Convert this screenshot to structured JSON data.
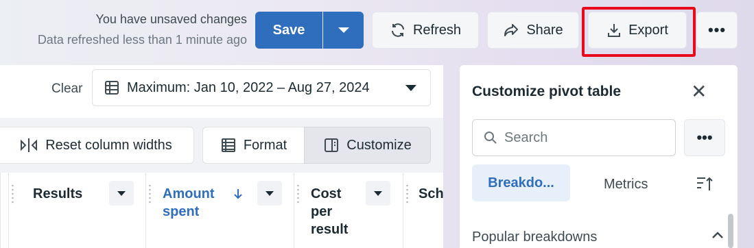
{
  "status": {
    "unsaved": "You have unsaved changes",
    "refreshed": "Data refreshed less than 1 minute ago"
  },
  "toolbar": {
    "save_label": "Save",
    "refresh_label": "Refresh",
    "share_label": "Share",
    "export_label": "Export",
    "more_label": "•••",
    "accent_color": "#2f6dbd",
    "highlight_color": "#e8091b"
  },
  "filters": {
    "clear_label": "Clear",
    "date_range": "Maximum: Jan 10, 2022 – Aug 27, 2024"
  },
  "table_toolbar": {
    "reset_label": "Reset column widths",
    "format_label": "Format",
    "customize_label": "Customize"
  },
  "columns": [
    {
      "line1": "Results",
      "line2": "",
      "line3": ""
    },
    {
      "line1": "Amount",
      "line2": "spent",
      "line3": "",
      "sort_icon": "arrow-down-icon"
    },
    {
      "line1": "Cost",
      "line2": "per",
      "line3": "result"
    },
    {
      "line1": "Sch",
      "line2": "",
      "line3": ""
    }
  ],
  "pivot_panel": {
    "title": "Customize pivot table",
    "close_label": "✕",
    "search_placeholder": "Search",
    "more_label": "•••",
    "tab_breakdowns": "Breakdo...",
    "tab_metrics": "Metrics",
    "section_popular": "Popular breakdowns"
  }
}
